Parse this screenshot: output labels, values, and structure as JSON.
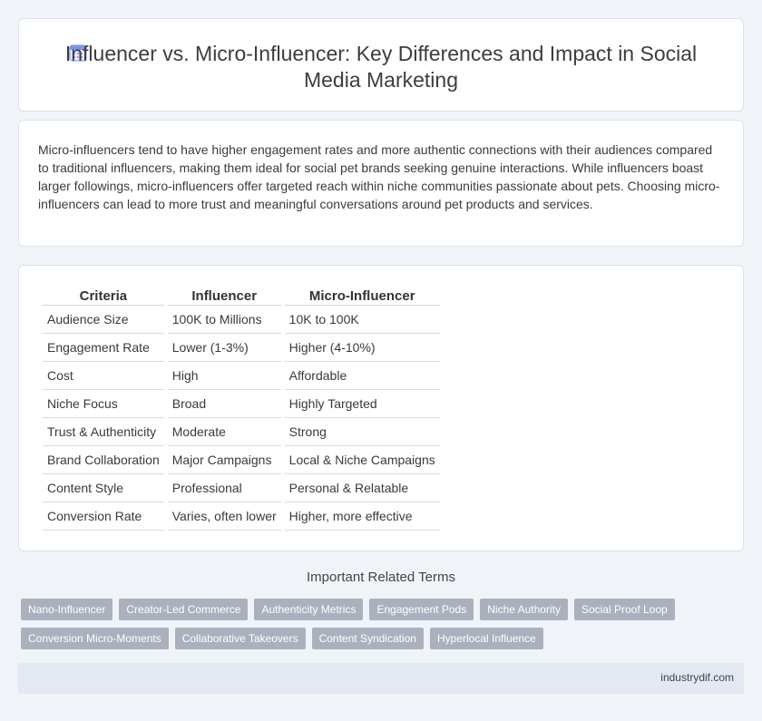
{
  "header": {
    "title": "Influencer vs. Micro-Influencer: Key Differences and Impact in Social Media Marketing",
    "icon": "calendar-icon"
  },
  "intro": {
    "text": "Micro-influencers tend to have higher engagement rates and more authentic connections with their audiences compared to traditional influencers, making them ideal for social pet brands seeking genuine interactions. While influencers boast larger followings, micro-influencers offer targeted reach within niche communities passionate about pets. Choosing micro-influencers can lead to more trust and meaningful conversations around pet products and services."
  },
  "table": {
    "headers": [
      "Criteria",
      "Influencer",
      "Micro-Influencer"
    ],
    "rows": [
      [
        "Audience Size",
        "100K to Millions",
        "10K to 100K"
      ],
      [
        "Engagement Rate",
        "Lower (1-3%)",
        "Higher (4-10%)"
      ],
      [
        "Cost",
        "High",
        "Affordable"
      ],
      [
        "Niche Focus",
        "Broad",
        "Highly Targeted"
      ],
      [
        "Trust & Authenticity",
        "Moderate",
        "Strong"
      ],
      [
        "Brand Collaboration",
        "Major Campaigns",
        "Local & Niche Campaigns"
      ],
      [
        "Content Style",
        "Professional",
        "Personal & Relatable"
      ],
      [
        "Conversion Rate",
        "Varies, often lower",
        "Higher, more effective"
      ]
    ]
  },
  "related": {
    "heading": "Important Related Terms",
    "terms": [
      "Nano-Influencer",
      "Creator-Led Commerce",
      "Authenticity Metrics",
      "Engagement Pods",
      "Niche Authority",
      "Social Proof Loop",
      "Conversion Micro-Moments",
      "Collaborative Takeovers",
      "Content Syndication",
      "Hyperlocal Influence"
    ]
  },
  "footer": {
    "site": "industrydif.com"
  },
  "colors": {
    "background": "#f0f3f8",
    "tag": "#aab1bd",
    "footer": "#e3e9f3"
  }
}
